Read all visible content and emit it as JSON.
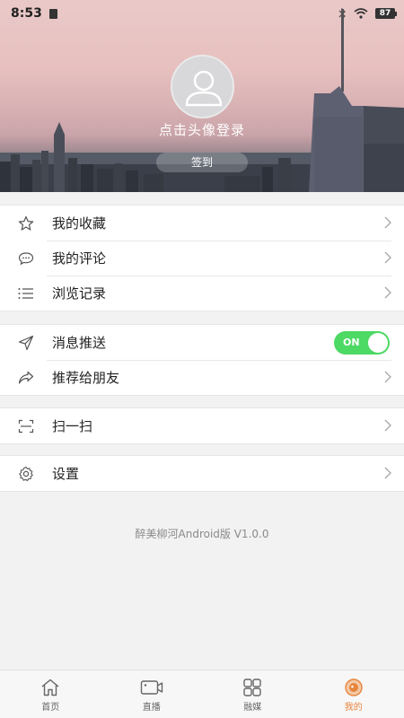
{
  "status_bar": {
    "time": "8:53",
    "battery": "87"
  },
  "profile": {
    "login_prompt": "点击头像登录",
    "checkin_label": "签到"
  },
  "menu_group_1": [
    {
      "label": "我的收藏",
      "icon": "star-icon"
    },
    {
      "label": "我的评论",
      "icon": "comment-icon"
    },
    {
      "label": "浏览记录",
      "icon": "list-icon"
    }
  ],
  "menu_group_2": {
    "push": {
      "label": "消息推送",
      "icon": "send-icon",
      "toggle_label": "ON",
      "enabled": true
    },
    "share": {
      "label": "推荐给朋友",
      "icon": "share-icon"
    }
  },
  "menu_group_3": {
    "scan": {
      "label": "扫一扫",
      "icon": "scan-icon"
    }
  },
  "menu_group_4": {
    "settings": {
      "label": "设置",
      "icon": "gear-icon"
    }
  },
  "version_text": "醉美柳河Android版 V1.0.0",
  "tabs": [
    {
      "label": "首页",
      "icon": "home-icon"
    },
    {
      "label": "直播",
      "icon": "video-icon"
    },
    {
      "label": "融媒",
      "icon": "grid-icon"
    },
    {
      "label": "我的",
      "icon": "profile-icon",
      "active": true
    }
  ],
  "colors": {
    "accent": "#e8843c",
    "toggle_on": "#4cd964",
    "background": "#f2f2f2"
  }
}
